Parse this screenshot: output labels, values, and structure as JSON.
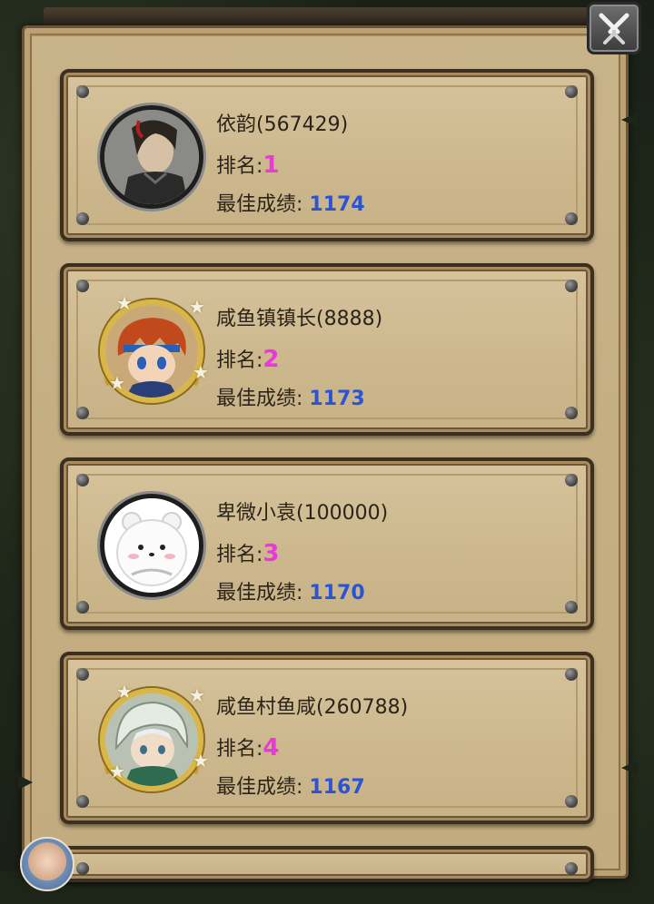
{
  "close_button": {
    "icon": "crossed-swords-icon"
  },
  "colors": {
    "rank": "#e83ad8",
    "score": "#2a53d6",
    "text": "#2c2418",
    "parchment": "#cdb88e"
  },
  "players": [
    {
      "name": "依韵(567429)",
      "rank_label": "排名:",
      "rank": "1",
      "score_label": "最佳成绩:",
      "score": "1174",
      "avatar": "swordsman-portrait-icon",
      "frame": "plain"
    },
    {
      "name": "咸鱼镇镇长(8888)",
      "rank_label": "排名:",
      "rank": "2",
      "score_label": "最佳成绩:",
      "score": "1173",
      "avatar": "red-haired-hero-portrait-icon",
      "frame": "gold"
    },
    {
      "name": "卑微小袁(100000)",
      "rank_label": "排名:",
      "rank": "3",
      "score_label": "最佳成绩:",
      "score": "1170",
      "avatar": "white-bear-portrait-icon",
      "frame": "plain"
    },
    {
      "name": "咸鱼村鱼咸(260788)",
      "rank_label": "排名:",
      "rank": "4",
      "score_label": "最佳成绩:",
      "score": "1167",
      "avatar": "hooded-boy-portrait-icon",
      "frame": "gold"
    }
  ]
}
